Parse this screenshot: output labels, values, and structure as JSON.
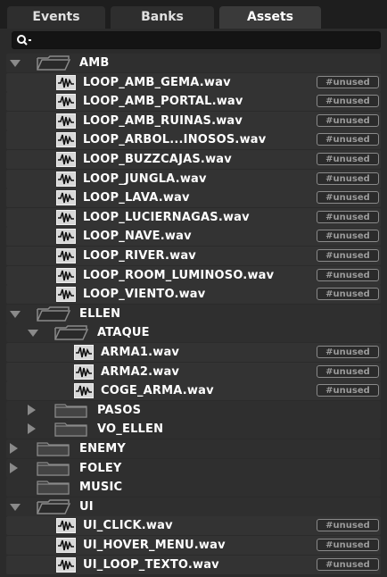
{
  "tabs": [
    {
      "label": "Events"
    },
    {
      "label": "Banks"
    },
    {
      "label": "Assets"
    }
  ],
  "search": {
    "placeholder": "",
    "value": ""
  },
  "colors": {
    "background": "#2b2b2b",
    "row": "#333333",
    "text": "#ffffff",
    "badge": "#9a9a9a"
  },
  "tree": {
    "amb": {
      "label": "AMB",
      "files": [
        "LOOP_AMB_GEMA.wav",
        "LOOP_AMB_PORTAL.wav",
        "LOOP_AMB_RUINAS.wav",
        "LOOP_ARBOL...INOSOS.wav",
        "LOOP_BUZZCAJAS.wav",
        "LOOP_JUNGLA.wav",
        "LOOP_LAVA.wav",
        "LOOP_LUCIERNAGAS.wav",
        "LOOP_NAVE.wav",
        "LOOP_RIVER.wav",
        "LOOP_ROOM_LUMINOSO.wav",
        "LOOP_VIENTO.wav"
      ]
    },
    "ellen": {
      "label": "ELLEN",
      "ataque": {
        "label": "ATAQUE",
        "files": [
          "ARMA1.wav",
          "ARMA2.wav",
          "COGE_ARMA.wav"
        ]
      },
      "pasos": {
        "label": "PASOS"
      },
      "vo_ellen": {
        "label": "VO_ELLEN"
      }
    },
    "enemy": {
      "label": "ENEMY"
    },
    "foley": {
      "label": "FOLEY"
    },
    "music": {
      "label": "MUSIC"
    },
    "ui": {
      "label": "UI",
      "files": [
        "UI_CLICK.wav",
        "UI_HOVER_MENU.wav",
        "UI_LOOP_TEXTO.wav"
      ]
    }
  },
  "badge_label": "#unused"
}
